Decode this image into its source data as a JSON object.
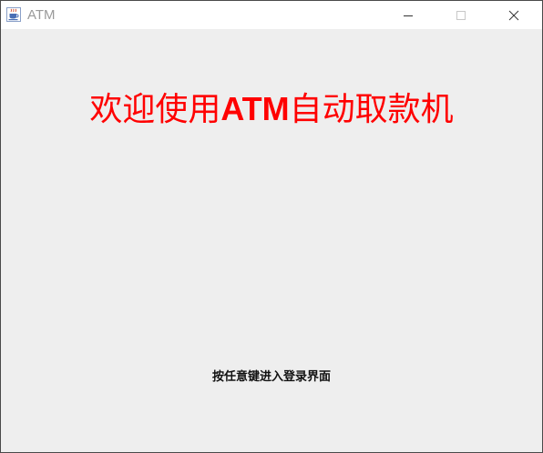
{
  "window": {
    "title": "ATM",
    "icon": "java-coffee-cup-icon",
    "controls": {
      "minimize": "minimize-icon",
      "maximize": "maximize-icon",
      "close": "close-icon"
    }
  },
  "welcome": {
    "prefix": "欢迎使用",
    "brand": "ATM",
    "suffix": "自动取款机",
    "color": "#ff0000"
  },
  "hint": {
    "text": "按任意键进入登录界面"
  }
}
